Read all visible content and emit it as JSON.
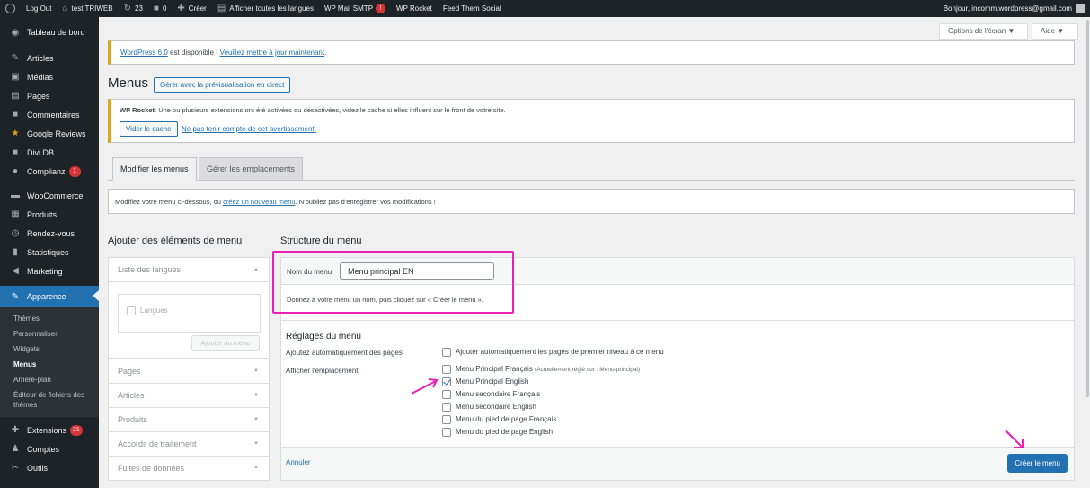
{
  "adminbar": {
    "logout": "Log Out",
    "site_name": "test TRIWEB",
    "updates_count": "23",
    "comments_count": "0",
    "create": "Créer",
    "languages": "Afficher toutes les langues",
    "mail_smtp": "WP Mail SMTP",
    "mail_smtp_badge": "!",
    "rocket": "WP Rocket",
    "feed": "Feed Them Social",
    "greeting": "Bonjour, incomm.wordpress@gmail.com"
  },
  "sidebar": {
    "items": [
      {
        "label": "Tableau de bord",
        "icon": "dashboard-icon",
        "glyph": "◉"
      },
      {
        "label": "Articles",
        "icon": "pin-icon",
        "glyph": "✎"
      },
      {
        "label": "Médias",
        "icon": "media-icon",
        "glyph": "▣"
      },
      {
        "label": "Pages",
        "icon": "pages-icon",
        "glyph": "▤"
      },
      {
        "label": "Commentaires",
        "icon": "comments-icon",
        "glyph": "■"
      },
      {
        "label": "Google Reviews",
        "icon": "star-icon",
        "glyph": "★"
      },
      {
        "label": "Divi DB",
        "icon": "divi-icon",
        "glyph": "■"
      },
      {
        "label": "Complianz",
        "icon": "complianz-icon",
        "glyph": "●",
        "badge": "1"
      },
      {
        "label": "WooCommerce",
        "icon": "woocommerce-icon",
        "glyph": "▬"
      },
      {
        "label": "Produits",
        "icon": "products-icon",
        "glyph": "▦"
      },
      {
        "label": "Rendez-vous",
        "icon": "clock-icon",
        "glyph": "◷"
      },
      {
        "label": "Statistiques",
        "icon": "stats-icon",
        "glyph": "▮"
      },
      {
        "label": "Marketing",
        "icon": "megaphone-icon",
        "glyph": "◀"
      },
      {
        "label": "Apparence",
        "icon": "brush-icon",
        "glyph": "✎"
      }
    ],
    "submenu": [
      "Thèmes",
      "Personnaliser",
      "Widgets",
      "Menus",
      "Arrière-plan",
      "Éditeur de fichiers des thèmes"
    ],
    "after": [
      {
        "label": "Extensions",
        "icon": "plugins-icon",
        "glyph": "✚",
        "badge": "21"
      },
      {
        "label": "Comptes",
        "icon": "users-icon",
        "glyph": "♟"
      },
      {
        "label": "Outils",
        "icon": "tools-icon",
        "glyph": "✂"
      }
    ]
  },
  "screen_options": "Options de l'écran ▼",
  "help": "Aide ▼",
  "update_notice": {
    "version_link": "WordPress 6.0",
    "text": " est disponible ! ",
    "update_link": "Veuillez mettre à jour maintenant",
    "end": "."
  },
  "page": {
    "title": "Menus",
    "live_preview": "Gérer avec la prévisualisation en direct"
  },
  "rocket_notice": {
    "bold": "WP Rocket",
    "text": ": Une ou plusieurs extensions ont été activées ou désactivées, videz le cache si elles influent sur le front de votre site.",
    "clear_cache": "Vider le cache",
    "ignore": "Ne pas tenir compte de cet avertissement."
  },
  "tabs": {
    "edit": "Modifier les menus",
    "locations": "Gérer les emplacements"
  },
  "info": {
    "before": "Modifiez votre menu ci-dessous, ou ",
    "link": "créez un nouveau menu",
    "after": ". N'oubliez pas d'enregistrer vos modifications !"
  },
  "left": {
    "heading": "Ajouter des éléments de menu",
    "languages_section": "Liste des langues",
    "languages_checkbox": "Langues",
    "add_button": "Ajouter au menu",
    "sections": [
      "Pages",
      "Articles",
      "Produits",
      "Accords de traitement",
      "Fuites de données"
    ]
  },
  "structure": {
    "heading": "Structure du menu",
    "name_label": "Nom du menu",
    "name_value": "Menu principal EN",
    "hint": "Donnez à votre menu un nom, puis cliquez sur « Créer le menu ».",
    "settings_heading": "Réglages du menu",
    "auto_label": "Ajoutez automatiquement des pages",
    "auto_option": "Ajouter automatiquement les pages de premier niveau à ce menu",
    "location_label": "Afficher l'emplacement",
    "locations": [
      {
        "label": "Menu Principal Français",
        "note": "(Actuellement réglé sur : Menu-principal)",
        "checked": false
      },
      {
        "label": "Menu Principal English",
        "note": "",
        "checked": true
      },
      {
        "label": "Menu secondaire Français",
        "note": "",
        "checked": false
      },
      {
        "label": "Menu secondaire English",
        "note": "",
        "checked": false
      },
      {
        "label": "Menu du pied de page Français",
        "note": "",
        "checked": false
      },
      {
        "label": "Menu du pied de page English",
        "note": "",
        "checked": false
      }
    ],
    "cancel": "Annuler",
    "create": "Créer le menu"
  },
  "colors": {
    "accent": "#2271b1",
    "annotation": "#e91eb4",
    "admin_bg": "#1d2327"
  }
}
